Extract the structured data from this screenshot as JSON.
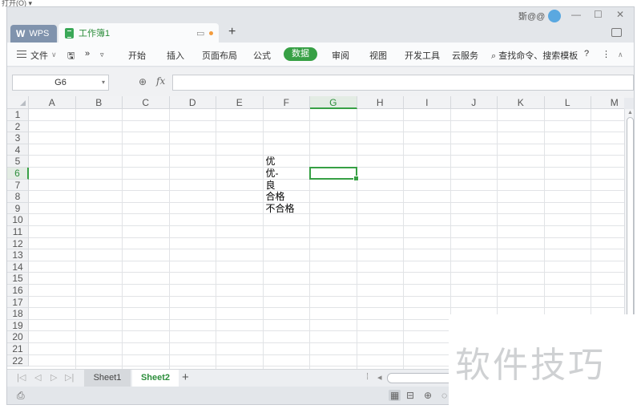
{
  "top": {
    "fragment": "打开(O) ▾"
  },
  "tabs": {
    "wps_label": "WPS",
    "workbook_label": "工作簿1",
    "new_tab": "+"
  },
  "user": {
    "name": "斲@@"
  },
  "window": {
    "minimize": "—",
    "maximize": "☐",
    "close": "✕"
  },
  "menu": {
    "file": "文件",
    "items": [
      "开始",
      "插入",
      "页面布局",
      "公式",
      "数据",
      "审阅",
      "视图",
      "开发工具",
      "云服务"
    ],
    "active": "数据",
    "search": "查找命令、搜索模板",
    "help": "?",
    "more": "⋮"
  },
  "formula": {
    "cell_ref": "G6",
    "fx": "fx",
    "value": ""
  },
  "columns": [
    "A",
    "B",
    "C",
    "D",
    "E",
    "F",
    "G",
    "H",
    "I",
    "J",
    "K",
    "L",
    "M"
  ],
  "active_column": "G",
  "rows": [
    "1",
    "2",
    "3",
    "4",
    "5",
    "6",
    "7",
    "8",
    "9",
    "10",
    "11",
    "12",
    "13",
    "14",
    "15",
    "16",
    "17",
    "18",
    "19",
    "20",
    "21",
    "22"
  ],
  "active_row": "6",
  "cells": [
    {
      "ref": "F5",
      "value": "优"
    },
    {
      "ref": "F6",
      "value": "优-"
    },
    {
      "ref": "F7",
      "value": "良"
    },
    {
      "ref": "F8",
      "value": "合格"
    },
    {
      "ref": "F9",
      "value": "不合格"
    }
  ],
  "sheets": [
    "Sheet1",
    "Sheet2"
  ],
  "active_sheet": "Sheet2",
  "watermark": "软件技巧",
  "colors": {
    "accent": "#37a045",
    "tab_inactive": "#8093ad"
  }
}
